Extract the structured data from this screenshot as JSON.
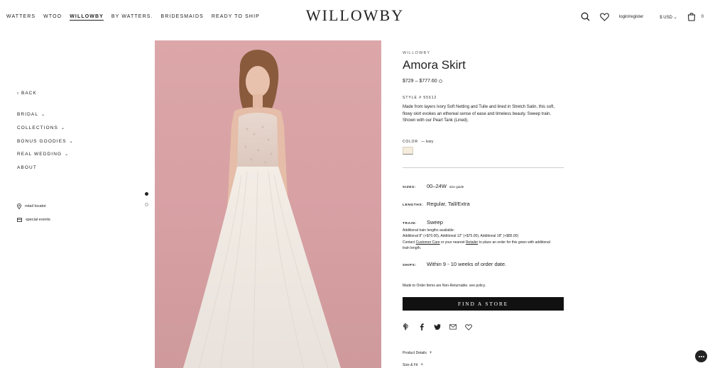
{
  "nav": {
    "items": [
      "WATTERS",
      "WTOO",
      "WILLOWBY",
      "BY WATTERS.",
      "BRIDESMAIDS",
      "READY TO SHIP"
    ],
    "active": "WILLOWBY"
  },
  "logo": "WILLOWBY",
  "header": {
    "login": "login/register",
    "currency": "$ USD",
    "cart_count": "0"
  },
  "sidebar": {
    "back": "BACK",
    "menu": [
      {
        "label": "BRIDAL",
        "has_chevron": true
      },
      {
        "label": "COLLECTIONS",
        "has_chevron": true
      },
      {
        "label": "BONUS GOODIES",
        "has_chevron": true
      },
      {
        "label": "REAL WEDDING",
        "has_chevron": true
      },
      {
        "label": "ABOUT",
        "has_chevron": false
      }
    ],
    "links": [
      {
        "label": "retail locator",
        "icon": "location-pin-icon"
      },
      {
        "label": "special events",
        "icon": "calendar-icon"
      }
    ]
  },
  "gallery": {
    "active_index": 0,
    "count": 2
  },
  "product": {
    "brand": "WILLOWBY",
    "title": "Amora Skirt",
    "price": "$729 – $777.60",
    "style": "STYLE # 55612",
    "description": "Made from layers Ivory Soft Netting and Tulle and lined in Stretch Satin, this soft, flowy skirt evokes an ethereal sense of ease and timeless beauty. Sweep train. Shown with our Pearl Tank (Lined).",
    "color_label": "COLOR",
    "color_value": "— Ivory",
    "swatch_color": "#f5ecdc",
    "sizes_label": "SIZES:",
    "sizes_value": "00–24W",
    "size_guide": "size guide",
    "lengths_label": "LENGTHS:",
    "lengths_value": "Regular, Tall/Extra",
    "train_label": "TRAIN:",
    "train_value": "Sweep",
    "train_note_1": "Additional train lengths available:",
    "train_note_2": "Additional 8\" (+$70.00), Additional 12\" (+$75.00), Additional 18\" (+$85.00)",
    "train_note_3a": "Contact ",
    "train_note_3b": "Customer Care",
    "train_note_3c": " or your nearest ",
    "train_note_3d": "Retailer",
    "train_note_3e": " to place an order for this gown with additional train length.",
    "ships_label": "SHIPS:",
    "ships_value": "Within 9 - 10 weeks of order date.",
    "nonreturnable": "Made to Order Items are Non-Returnable. see policy.",
    "find_store": "FIND A STORE",
    "accordions": [
      "Product Details",
      "Size & Fit"
    ]
  }
}
